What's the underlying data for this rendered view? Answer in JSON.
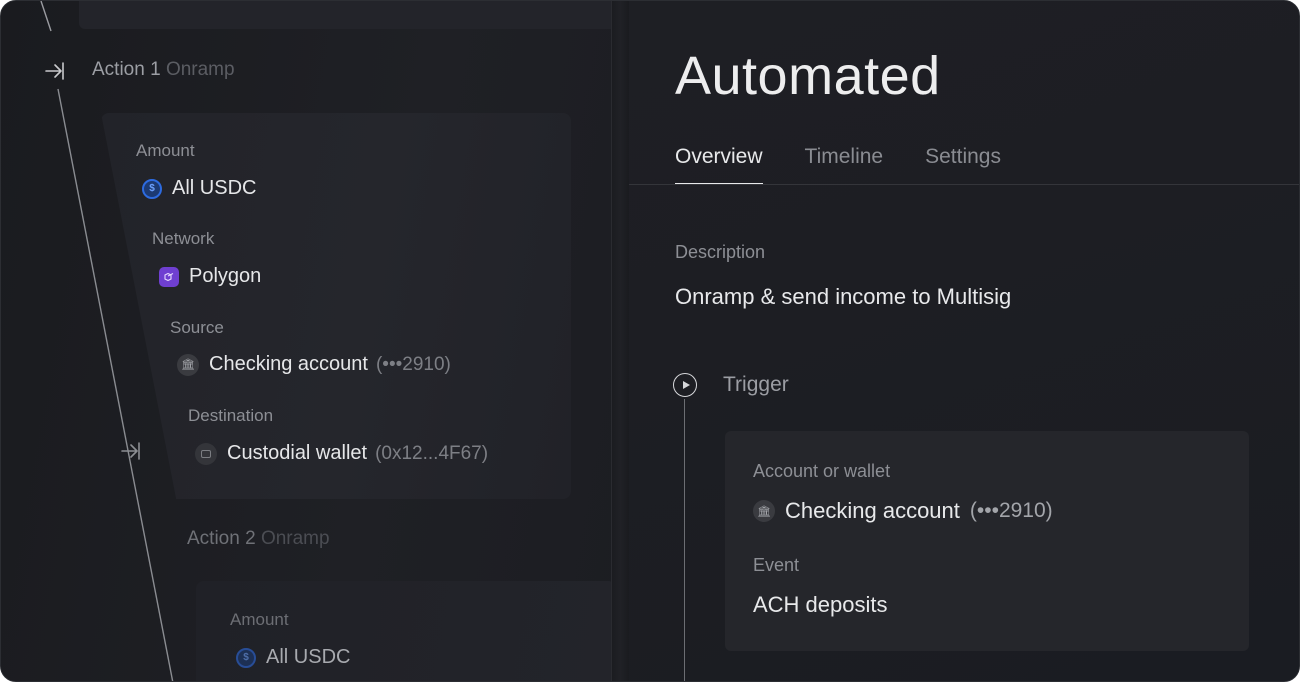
{
  "left": {
    "action1": {
      "title": "Action 1",
      "subtitle": "Onramp"
    },
    "amount": {
      "label": "Amount",
      "value": "All USDC"
    },
    "network": {
      "label": "Network",
      "value": "Polygon"
    },
    "source": {
      "label": "Source",
      "value": "Checking account",
      "suffix": "(•••2910)"
    },
    "destination": {
      "label": "Destination",
      "value": "Custodial wallet",
      "suffix": "(0x12...4F67)"
    },
    "action2": {
      "title": "Action 2",
      "subtitle": "Onramp"
    },
    "amount2": {
      "label": "Amount",
      "value": "All USDC"
    }
  },
  "right": {
    "title": "Automated",
    "tabs": [
      "Overview",
      "Timeline",
      "Settings"
    ],
    "active_tab": "Overview",
    "description": {
      "label": "Description",
      "value": "Onramp & send income to Multisig"
    },
    "trigger": {
      "label": "Trigger",
      "account": {
        "label": "Account or wallet",
        "value": "Checking account",
        "suffix": "(•••2910)"
      },
      "event": {
        "label": "Event",
        "value": "ACH deposits"
      }
    }
  },
  "colors": {
    "usdc": "#2d6be0",
    "polygon": "#6f3fd1",
    "background": "#1d1e23"
  }
}
